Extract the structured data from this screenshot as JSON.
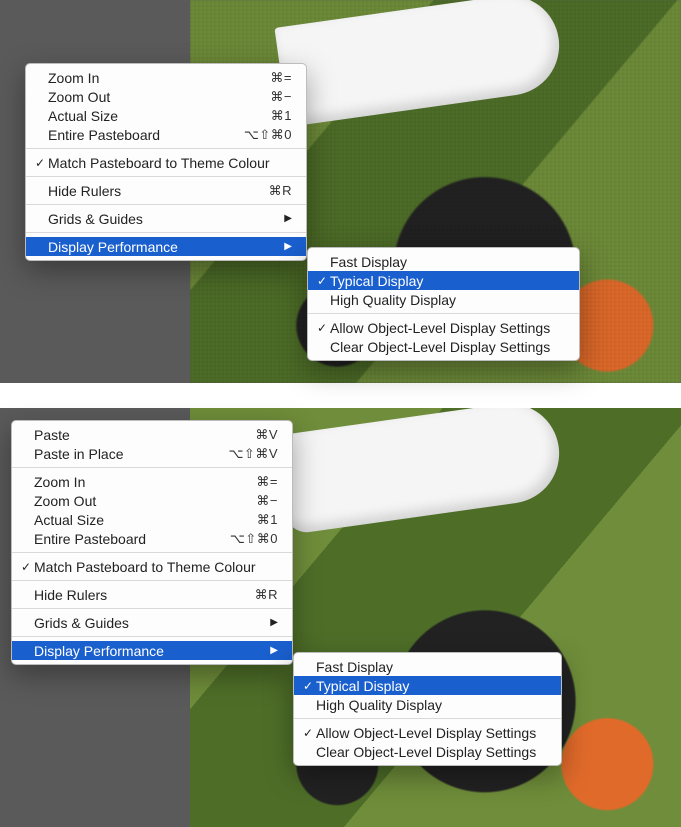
{
  "menu_top": {
    "items": [
      {
        "label": "Zoom In",
        "shortcut": "⌘="
      },
      {
        "label": "Zoom Out",
        "shortcut": "⌘−"
      },
      {
        "label": "Actual Size",
        "shortcut": "⌘1"
      },
      {
        "label": "Entire Pasteboard",
        "shortcut": "⌥⇧⌘0"
      }
    ],
    "match_pasteboard": "Match Pasteboard to Theme Colour",
    "hide_rulers": {
      "label": "Hide Rulers",
      "shortcut": "⌘R"
    },
    "grids": "Grids & Guides",
    "display_perf": "Display Performance"
  },
  "submenu_top": {
    "fast": "Fast Display",
    "typical": "Typical Display",
    "high": "High Quality Display",
    "allow": "Allow Object-Level Display Settings",
    "clear": "Clear Object-Level Display Settings"
  },
  "menu_bottom": {
    "paste": {
      "label": "Paste",
      "shortcut": "⌘V"
    },
    "paste_place": {
      "label": "Paste in Place",
      "shortcut": "⌥⇧⌘V"
    },
    "items": [
      {
        "label": "Zoom In",
        "shortcut": "⌘="
      },
      {
        "label": "Zoom Out",
        "shortcut": "⌘−"
      },
      {
        "label": "Actual Size",
        "shortcut": "⌘1"
      },
      {
        "label": "Entire Pasteboard",
        "shortcut": "⌥⇧⌘0"
      }
    ],
    "match_pasteboard": "Match Pasteboard to Theme Colour",
    "hide_rulers": {
      "label": "Hide Rulers",
      "shortcut": "⌘R"
    },
    "grids": "Grids & Guides",
    "display_perf": "Display Performance"
  },
  "submenu_bottom": {
    "fast": "Fast Display",
    "typical": "Typical Display",
    "high": "High Quality Display",
    "allow": "Allow Object-Level Display Settings",
    "clear": "Clear Object-Level Display Settings"
  }
}
